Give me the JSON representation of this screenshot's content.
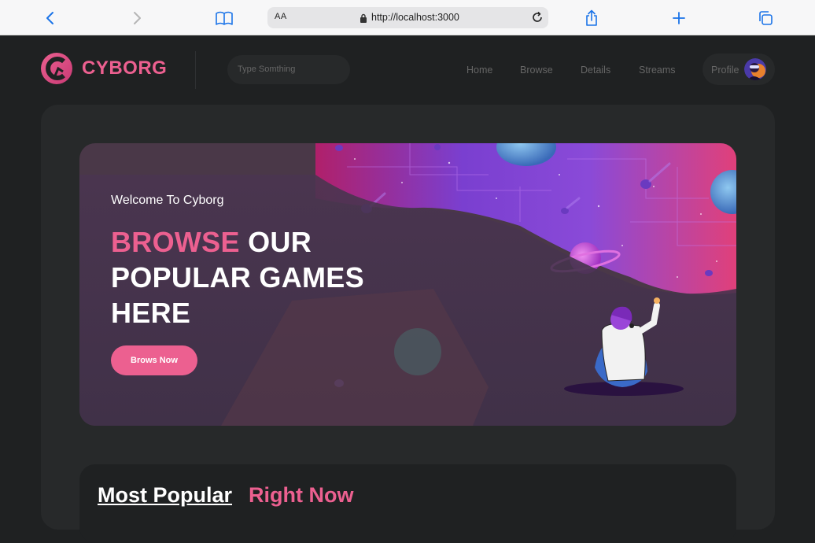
{
  "browser": {
    "aa_label": "AA",
    "url": "http://localhost:3000"
  },
  "header": {
    "brand": "CYBORG",
    "search_placeholder": "Type Somthing",
    "nav": [
      {
        "label": "Home"
      },
      {
        "label": "Browse"
      },
      {
        "label": "Details"
      },
      {
        "label": "Streams"
      }
    ],
    "profile_label": "Profile"
  },
  "banner": {
    "welcome": "Welcome To Cyborg",
    "headline_pink": "BROWSE",
    "headline_line1_rest": "OUR",
    "headline_line2": "POPULAR GAMES",
    "headline_line3": "HERE",
    "cta_label": "Brows Now"
  },
  "popular": {
    "title_part1": "Most Popular",
    "title_part2": "Right Now"
  },
  "colors": {
    "accent": "#ec6090",
    "background": "#1f2122",
    "panel": "#27292a"
  },
  "icons": [
    "back-icon",
    "forward-icon",
    "bookmarks-icon",
    "lock-icon",
    "reload-icon",
    "share-icon",
    "new-tab-icon",
    "tabs-icon"
  ]
}
